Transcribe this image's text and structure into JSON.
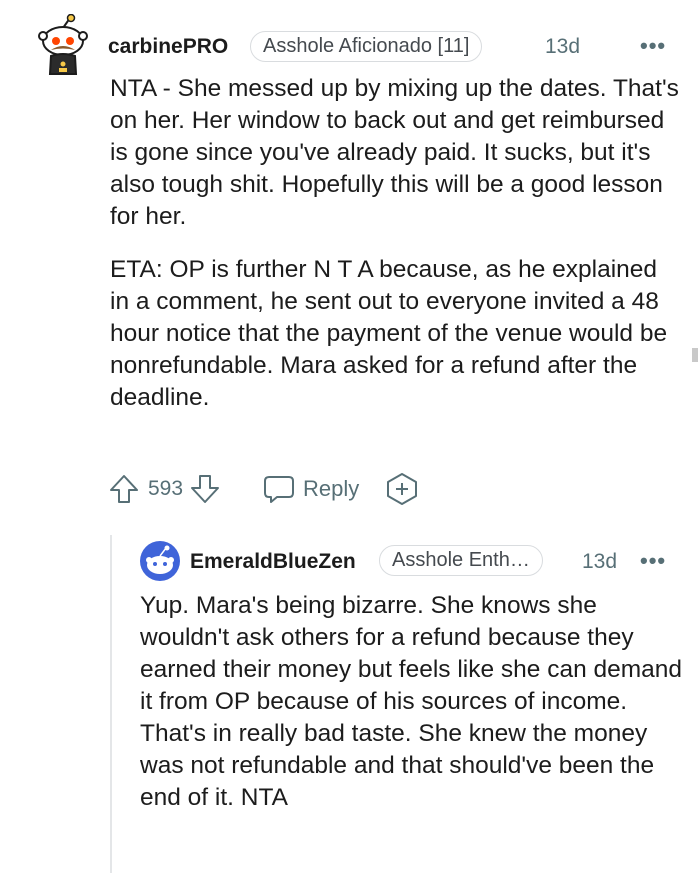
{
  "comment": {
    "username": "carbinePRO",
    "flair": "Asshole Aficionado [11]",
    "age": "13d",
    "more": "•••",
    "paragraphs": [
      "NTA - She messed up by mixing up the dates. That's on her. Her window to back out and get reimbursed is gone since you've already paid. It sucks, but it's also tough shit. Hopefully this will be a good lesson for her.",
      "ETA: OP is further N T A because, as he explained in a comment, he sent out to everyone invited a 48 hour notice that the payment of the venue would be nonrefundable. Mara asked for a refund after the deadline."
    ],
    "vote_count": "593",
    "reply_label": "Reply",
    "icons": {
      "avatar": "snoo-avatar",
      "upvote": "upvote-arrow-icon",
      "downvote": "downvote-arrow-icon",
      "reply": "speech-bubble-icon",
      "award": "add-award-icon"
    }
  },
  "reply": {
    "username": "EmeraldBlueZen",
    "flair": "Asshole Enth…",
    "age": "13d",
    "more": "•••",
    "paragraphs": [
      "Yup. Mara's being bizarre. She knows she wouldn't ask others for a refund because they earned their money but feels like she can demand it from OP because of his sources of income. That's in really bad taste. She knew the money was not refundable and that should've been the end of it. NTA"
    ],
    "icons": {
      "avatar": "snoo-avatar"
    }
  },
  "colors": {
    "text": "#1c1c1c",
    "meta": "#576f76",
    "flair_border": "#d9dcdf",
    "avatar_blue": "#3f64d9"
  }
}
